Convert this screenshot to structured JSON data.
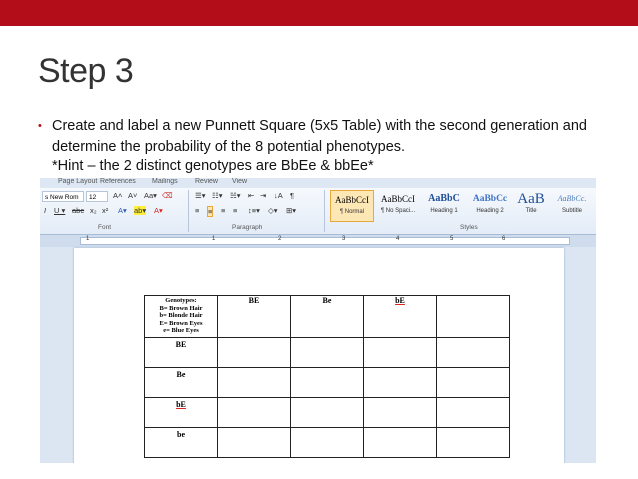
{
  "slide": {
    "title": "Step 3",
    "bullet_text": "Create and label a new Punnett Square (5x5 Table) with the second generation and determine the probability of the 8 potential phenotypes.",
    "hint": "*Hint – the 2 distinct genotypes are BbEe & bbEe*",
    "accent_color": "#b30d1a"
  },
  "word": {
    "tabs": [
      "Page Layout",
      "References",
      "Mailings",
      "Review",
      "View"
    ],
    "font_name": "s New Rom",
    "font_size": "12",
    "groups": {
      "font": "Font",
      "paragraph": "Paragraph",
      "styles": "Styles"
    },
    "styles": [
      {
        "sample": "AaBbCcI",
        "name": "¶ Normal"
      },
      {
        "sample": "AaBbCcI",
        "name": "¶ No Spaci..."
      },
      {
        "sample": "AaBbC",
        "name": "Heading 1"
      },
      {
        "sample": "AaBbCc",
        "name": "Heading 2"
      },
      {
        "sample": "AaB",
        "name": "Title"
      },
      {
        "sample": "AaBbCc.",
        "name": "Subtitle"
      }
    ],
    "ruler_numbers": [
      "1",
      "1",
      "2",
      "3",
      "4",
      "5",
      "6"
    ],
    "table": {
      "corner_lines": [
        "Genotypes:",
        "B= Brown Hair",
        "b= Blonde Hair",
        "E= Brown Eyes",
        "e= Blue Eyes"
      ],
      "col_headers": [
        "BE",
        "Be",
        "bE",
        ""
      ],
      "row_headers": [
        "BE",
        "Be",
        "bE",
        "be"
      ]
    }
  }
}
